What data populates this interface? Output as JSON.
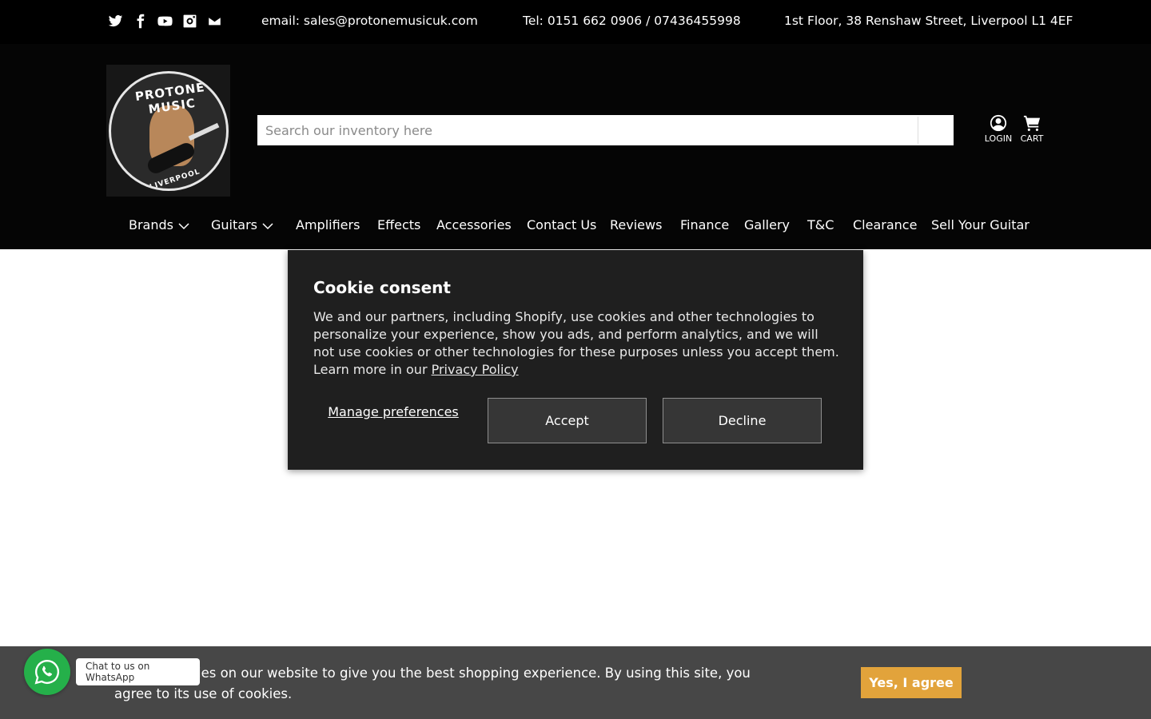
{
  "topbar": {
    "social": [
      {
        "icon": "twitter-icon"
      },
      {
        "icon": "facebook-icon"
      },
      {
        "icon": "youtube-icon"
      },
      {
        "icon": "instagram-icon"
      },
      {
        "icon": "mail-icon"
      }
    ],
    "email": "email: sales@protonemusicuk.com",
    "phone": "Tel: 0151 662 0906 / 07436455998",
    "address": "1st Floor, 38 Renshaw Street, Liverpool L1 4EF"
  },
  "logo": {
    "text_top": "PROTONE MUSIC",
    "text_bottom": "LIVERPOOL"
  },
  "search": {
    "placeholder": "Search our inventory here",
    "value": ""
  },
  "header_icons": {
    "login": "LOGIN",
    "cart": "CART"
  },
  "nav": [
    {
      "label": "Brands",
      "dropdown": true
    },
    {
      "label": "Guitars",
      "dropdown": true
    },
    {
      "label": "Amplifiers"
    },
    {
      "label": "Effects"
    },
    {
      "label": "Accessories"
    },
    {
      "label": "Contact Us"
    },
    {
      "label": "Reviews"
    },
    {
      "label": "Finance"
    },
    {
      "label": "Gallery"
    },
    {
      "label": "T&C"
    },
    {
      "label": "Clearance"
    },
    {
      "label": "Sell Your Guitar"
    }
  ],
  "cookie_modal": {
    "title": "Cookie consent",
    "body": "We and our partners, including Shopify, use cookies and other technologies to personalize your experience, show you ads, and perform analytics, and we will not use cookies or other technologies for these purposes unless you accept them. Learn more in our",
    "privacy_link": "Privacy Policy",
    "manage": "Manage preferences",
    "accept": "Accept",
    "decline": "Decline"
  },
  "cookie_bar": {
    "text": "We use cookies on our website to give you the best shopping experience. By using this site, you agree to its use of cookies.",
    "agree": "Yes, I agree"
  },
  "whatsapp": {
    "tooltip": "Chat to us on WhatsApp"
  },
  "colors": {
    "header_bg": "#050505",
    "modal_bg": "#1f1f1f",
    "cookiebar_bg": "#474747",
    "agree_btn": "#e2a33b",
    "whatsapp_green": "#25b04a"
  }
}
